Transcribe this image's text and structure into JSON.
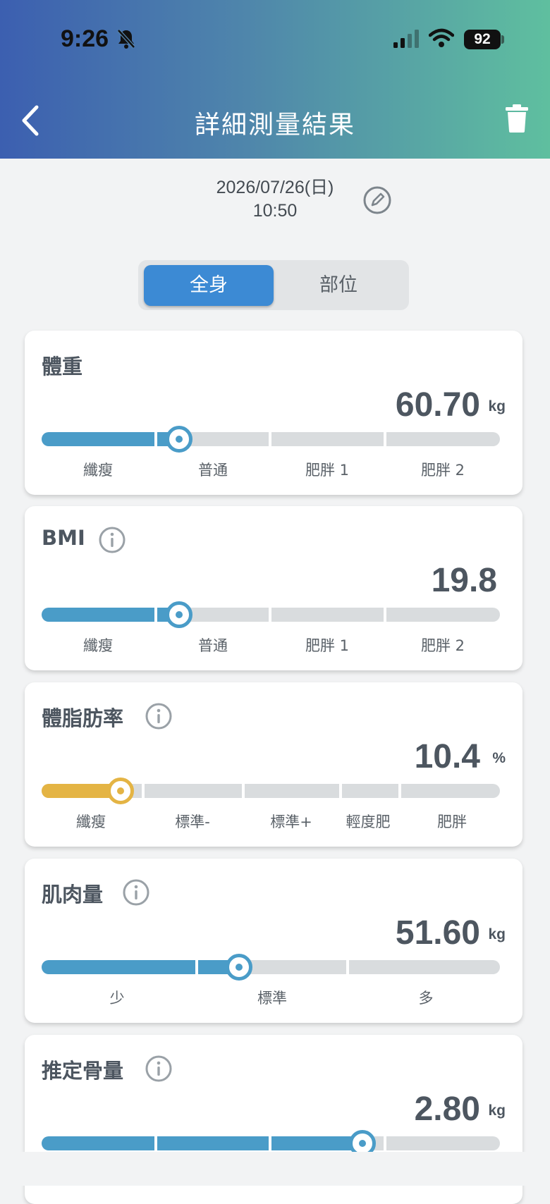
{
  "status_bar": {
    "time": "9:26",
    "battery": "92",
    "icons": [
      "bell-slash-icon",
      "signal-icon",
      "wifi-icon"
    ]
  },
  "header": {
    "title": "詳細測量結果",
    "back_icon": "chevron-left-icon",
    "delete_icon": "trash-icon"
  },
  "measurement": {
    "date": "2026/07/26(日)",
    "time": "10:50",
    "edit_icon": "pencil-icon"
  },
  "tabs": [
    {
      "label": "全身",
      "selected": true
    },
    {
      "label": "部位",
      "selected": false
    }
  ],
  "colors": {
    "accent": "#3c8ad4",
    "bar_fill": "#4a9cc8",
    "bar_fill_fat": "#e4b444",
    "bar_empty": "#d9dcde"
  },
  "cards": [
    {
      "title": "體重",
      "value": "60.70",
      "unit": "kg",
      "info": false,
      "labels": [
        "纖瘦",
        "普通",
        "肥胖 1",
        "肥胖 2"
      ],
      "marker_fraction": 0.3
    },
    {
      "title": "BMI",
      "value": "19.8",
      "unit": "",
      "info": true,
      "labels": [
        "纖瘦",
        "普通",
        "肥胖 1",
        "肥胖 2"
      ],
      "marker_fraction": 0.3
    },
    {
      "title": "體脂肪率",
      "value": "10.4",
      "unit": "%",
      "info": true,
      "labels": [
        "纖瘦",
        "標準-",
        "標準+",
        "輕度肥",
        "肥胖"
      ],
      "marker_fraction": 0.17
    },
    {
      "title": "肌肉量",
      "value": "51.60",
      "unit": "kg",
      "info": true,
      "labels": [
        "少",
        "標準",
        "多"
      ],
      "marker_fraction": 0.43
    },
    {
      "title": "推定骨量",
      "value": "2.80",
      "unit": "kg",
      "info": true,
      "labels": [],
      "marker_fraction": 0.7
    }
  ]
}
